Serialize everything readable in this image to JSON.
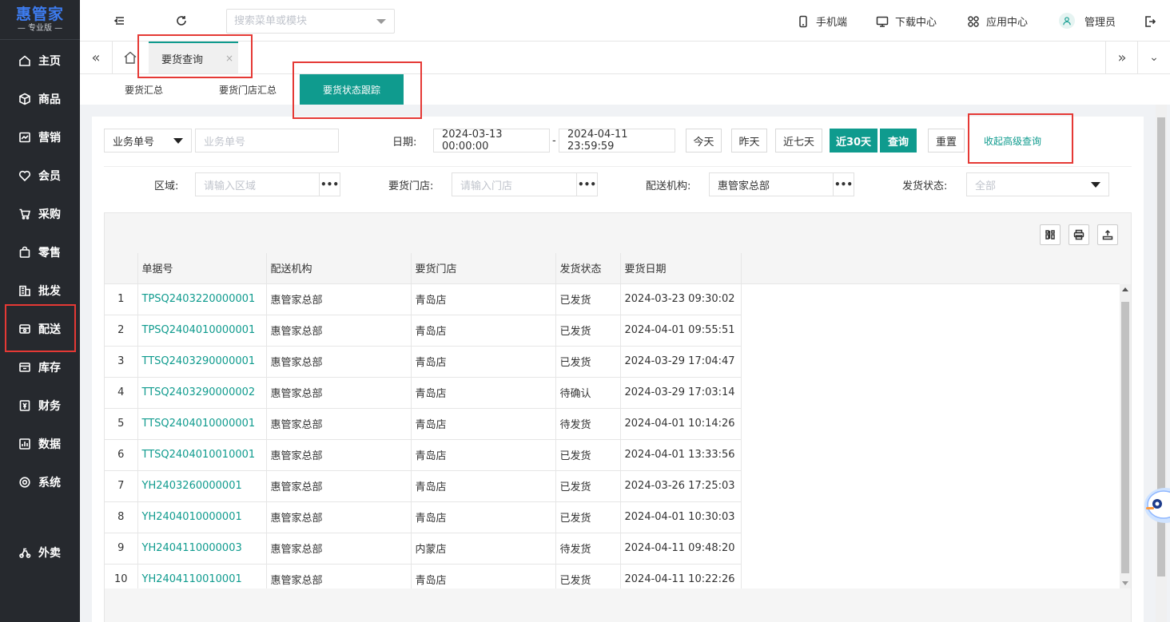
{
  "logo": {
    "brand": "惠管家",
    "edition": "— 专业版 —"
  },
  "sidebar": {
    "items": [
      {
        "label": "主页",
        "icon": "home-icon"
      },
      {
        "label": "商品",
        "icon": "box-icon"
      },
      {
        "label": "营销",
        "icon": "chart-icon"
      },
      {
        "label": "会员",
        "icon": "heart-icon"
      },
      {
        "label": "采购",
        "icon": "cart-icon"
      },
      {
        "label": "零售",
        "icon": "bag-icon"
      },
      {
        "label": "批发",
        "icon": "building-icon"
      },
      {
        "label": "配送",
        "icon": "truck-icon"
      },
      {
        "label": "库存",
        "icon": "warehouse-icon"
      },
      {
        "label": "财务",
        "icon": "yen-icon"
      },
      {
        "label": "数据",
        "icon": "bar-chart-icon"
      },
      {
        "label": "系统",
        "icon": "gear-icon"
      },
      {
        "label": "外卖",
        "icon": "scooter-icon"
      }
    ]
  },
  "header": {
    "search_placeholder": "搜索菜单或模块",
    "mobile": "手机端",
    "download": "下载中心",
    "apps": "应用中心",
    "user": "管理员"
  },
  "tabs": {
    "active": "要货查询",
    "close": "×"
  },
  "subtabs": {
    "summary": "要货汇总",
    "store_summary": "要货门店汇总",
    "tracking": "要货状态跟踪"
  },
  "filters": {
    "doc_type": "业务单号",
    "doc_placeholder": "业务单号",
    "date_label": "日期:",
    "date_start": "2024-03-13 00:00:00",
    "date_sep": "-",
    "date_end": "2024-04-11 23:59:59",
    "today": "今天",
    "yesterday": "昨天",
    "last7": "近七天",
    "last30": "近30天",
    "query": "查询",
    "reset": "重置",
    "collapse": "收起高级查询",
    "region_label": "区域:",
    "region_placeholder": "请输入区域",
    "store_label": "要货门店:",
    "store_placeholder": "请输入门店",
    "org_label": "配送机构:",
    "org_value": "惠管家总部",
    "status_label": "发货状态:",
    "status_value": "全部",
    "dots": "•••"
  },
  "table": {
    "columns": [
      "单据号",
      "配送机构",
      "要货门店",
      "发货状态",
      "要货日期"
    ],
    "rows": [
      {
        "idx": "1",
        "code": "TPSQ2403220000001",
        "org": "惠管家总部",
        "store": "青岛店",
        "status": "已发货",
        "date": "2024-03-23 09:30:02"
      },
      {
        "idx": "2",
        "code": "TPSQ2404010000001",
        "org": "惠管家总部",
        "store": "青岛店",
        "status": "已发货",
        "date": "2024-04-01 09:55:51"
      },
      {
        "idx": "3",
        "code": "TTSQ2403290000001",
        "org": "惠管家总部",
        "store": "青岛店",
        "status": "已发货",
        "date": "2024-03-29 17:04:47"
      },
      {
        "idx": "4",
        "code": "TTSQ2403290000002",
        "org": "惠管家总部",
        "store": "青岛店",
        "status": "待确认",
        "date": "2024-03-29 17:03:14"
      },
      {
        "idx": "5",
        "code": "TTSQ2404010000001",
        "org": "惠管家总部",
        "store": "青岛店",
        "status": "待发货",
        "date": "2024-04-01 10:14:26"
      },
      {
        "idx": "6",
        "code": "TTSQ2404010010001",
        "org": "惠管家总部",
        "store": "青岛店",
        "status": "已发货",
        "date": "2024-04-01 13:33:56"
      },
      {
        "idx": "7",
        "code": "YH2403260000001",
        "org": "惠管家总部",
        "store": "青岛店",
        "status": "已发货",
        "date": "2024-03-26 17:25:03"
      },
      {
        "idx": "8",
        "code": "YH2404010000001",
        "org": "惠管家总部",
        "store": "青岛店",
        "status": "已发货",
        "date": "2024-04-01 10:30:03"
      },
      {
        "idx": "9",
        "code": "YH2404110000003",
        "org": "惠管家总部",
        "store": "内蒙店",
        "status": "待发货",
        "date": "2024-04-11 09:48:20"
      },
      {
        "idx": "10",
        "code": "YH2404110010001",
        "org": "惠管家总部",
        "store": "青岛店",
        "status": "已发货",
        "date": "2024-04-11 10:22:26"
      }
    ]
  },
  "colors": {
    "accent": "#0f9b8e",
    "sidebar_bg": "#26292e",
    "annotation": "#e53935"
  }
}
